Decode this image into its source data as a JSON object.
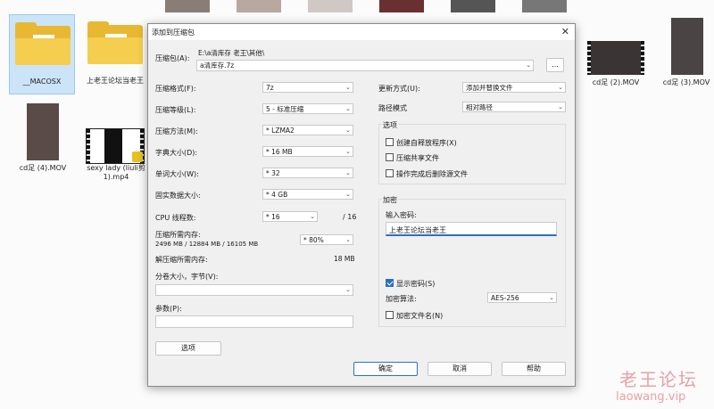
{
  "explorer": {
    "files": [
      {
        "name": "__MACOSX",
        "type": "folder"
      },
      {
        "name": "上老王论坛当老王",
        "type": "folder"
      },
      {
        "name": "cd足 (2).MOV",
        "type": "video"
      },
      {
        "name": "cd足 (3).MOV",
        "type": "video"
      },
      {
        "name": "cd足 (4).MOV",
        "type": "video"
      },
      {
        "name": "sexy lady (liuli剪",
        "name_line2": "1).mp4",
        "type": "video"
      }
    ]
  },
  "dialog": {
    "title": "添加到压缩包",
    "archive_label": "压缩包(A):",
    "archive_path": "E:\\a清库存 老王\\其他\\",
    "archive_name": "a清库存.7z",
    "browse_button": "...",
    "format_label": "压缩格式(F):",
    "format_value": "7z",
    "level_label": "压缩等级(L):",
    "level_value": "5 - 标准压缩",
    "method_label": "压缩方法(M):",
    "method_value": "* LZMA2",
    "dict_label": "字典大小(D):",
    "dict_value": "* 16 MB",
    "word_label": "单词大小(W):",
    "word_value": "* 32",
    "solid_label": "固实数据大小:",
    "solid_value": "* 4 GB",
    "cpu_label": "CPU 线程数:",
    "cpu_value": "* 16",
    "cpu_max": "/ 16",
    "mem_comp_label": "压缩所需内存:",
    "mem_comp_detail": "2496 MB / 12884 MB / 16105 MB",
    "mem_comp_value": "* 80%",
    "mem_decomp_label": "解压缩所需内存:",
    "mem_decomp_value": "18 MB",
    "split_label": "分卷大小，字节(V):",
    "split_value": "",
    "params_label": "参数(P):",
    "params_value": "",
    "options_button": "选项",
    "update_label": "更新方式(U):",
    "update_value": "添加并替换文件",
    "path_label": "路径模式",
    "path_value": "相对路径",
    "options_group": "选项",
    "opt_sfx": "创建自释放程序(X)",
    "opt_shared": "压缩共享文件",
    "opt_delete": "操作完成后删除源文件",
    "enc_group": "加密",
    "password_label": "输入密码:",
    "password_value": "上老王论坛当老王",
    "show_password": "显示密码(S)",
    "enc_method_label": "加密算法:",
    "enc_method_value": "AES-256",
    "enc_names": "加密文件名(N)",
    "ok_button": "确定",
    "cancel_button": "取消",
    "help_button": "帮助"
  },
  "watermark": {
    "line1": "老王论坛",
    "line2": "laowang.vip"
  },
  "colors": {
    "accent": "#2f6fc0",
    "folder": "#f5cd4f",
    "watermark": "#e8a0a8"
  }
}
